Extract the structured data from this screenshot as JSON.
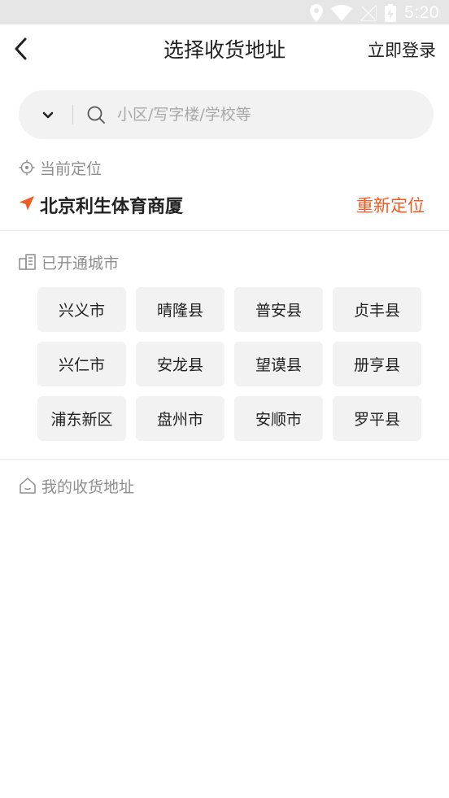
{
  "status_bar": {
    "time": "5:20",
    "icons": [
      "location-pin-icon",
      "wifi-icon",
      "signal-off-icon",
      "battery-charging-icon"
    ]
  },
  "header": {
    "title": "选择收货地址",
    "login_label": "立即登录",
    "back_icon": "chevron-left-icon"
  },
  "search": {
    "placeholder": "小区/写字楼/学校等",
    "dropdown_icon": "chevron-down-icon",
    "search_icon": "search-icon"
  },
  "current_location": {
    "label": "当前定位",
    "address": "北京利生体育商厦",
    "relocate_label": "重新定位",
    "accent_color": "#f15a22"
  },
  "open_cities": {
    "label": "已开通城市",
    "cities": [
      "兴义市",
      "晴隆县",
      "普安县",
      "贞丰县",
      "兴仁市",
      "安龙县",
      "望谟县",
      "册亨县",
      "浦东新区",
      "盘州市",
      "安顺市",
      "罗平县"
    ]
  },
  "my_addresses": {
    "label": "我的收货地址"
  }
}
